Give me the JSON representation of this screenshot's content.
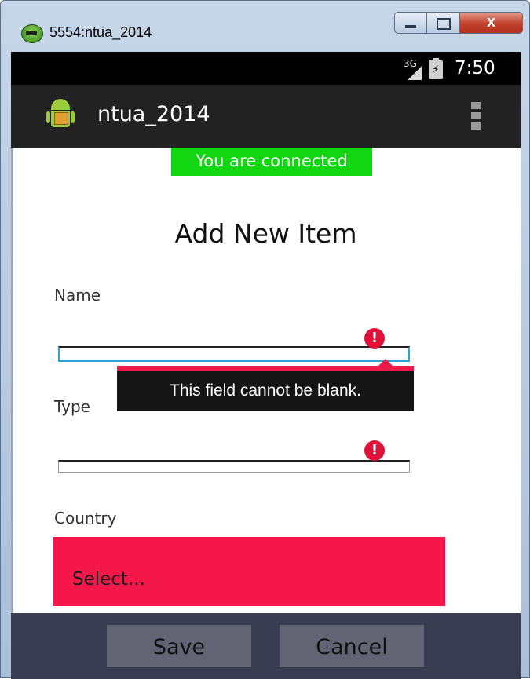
{
  "window": {
    "title": "5554:ntua_2014",
    "close_label": "x"
  },
  "statusbar": {
    "network": "3G",
    "time": "7:50"
  },
  "actionbar": {
    "app_title": "ntua_2014"
  },
  "banner": {
    "text": "You are connected",
    "color": "#11d611"
  },
  "form": {
    "title": "Add New Item",
    "name_label": "Name",
    "name_value": "",
    "type_label": "Type",
    "type_value": "",
    "country_label": "Country",
    "country_select_value": "Select...",
    "error_tooltip": "This field cannot be blank.",
    "error_icon": "!",
    "error_color": "#e0123a"
  },
  "buttons": {
    "save": "Save",
    "cancel": "Cancel"
  }
}
